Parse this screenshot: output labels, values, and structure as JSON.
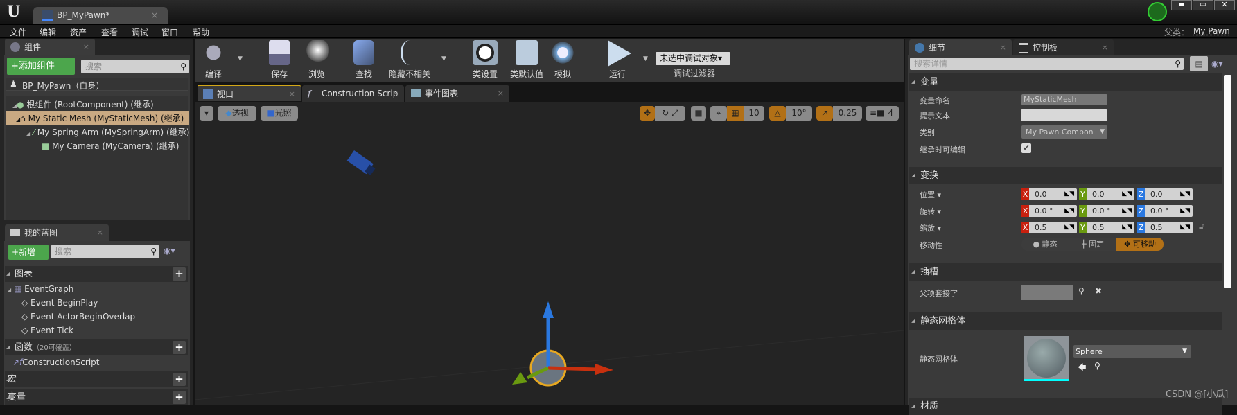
{
  "titlebar": {
    "tab_title": "BP_MyPawn*",
    "window_buttons": [
      "minimize",
      "maximize",
      "close"
    ]
  },
  "menu": [
    "文件",
    "编辑",
    "资产",
    "查看",
    "调试",
    "窗口",
    "帮助"
  ],
  "parent_class": {
    "label": "父类：",
    "value": "My Pawn"
  },
  "components": {
    "tab": "组件",
    "add_button": "+添加组件",
    "search_placeholder": "搜索",
    "self": "BP_MyPawn（自身）",
    "tree": [
      {
        "label": "根组件 (RootComponent) (继承)",
        "depth": 0,
        "selected": false
      },
      {
        "label": "My Static Mesh (MyStaticMesh) (继承)",
        "depth": 1,
        "selected": true
      },
      {
        "label": "My Spring Arm (MySpringArm) (继承)",
        "depth": 2,
        "selected": false
      },
      {
        "label": "My Camera (MyCamera) (继承)",
        "depth": 3,
        "selected": false
      }
    ]
  },
  "my_blueprint": {
    "tab": "我的蓝图",
    "new_button": "+新增",
    "search_placeholder": "搜索",
    "graphs": "图表",
    "event_graph": "EventGraph",
    "events": [
      "Event BeginPlay",
      "Event ActorBeginOverlap",
      "Event Tick"
    ],
    "functions": "函数",
    "functions_note": "（20可覆盖）",
    "construction_script": "ConstructionScript",
    "macros": "宏",
    "variables": "变量"
  },
  "toolbar": {
    "compile": "编译",
    "save": "保存",
    "browse": "浏览",
    "find": "查找",
    "hide_unrelated": "隐藏不相关",
    "class_settings": "类设置",
    "class_defaults": "类默认值",
    "simulate": "模拟",
    "play": "运行",
    "debug_object": "未选中调试对象▾",
    "debug_filter": "调试过滤器"
  },
  "editor_tabs": [
    "视口",
    "Construction Scrip",
    "事件图表"
  ],
  "viewport": {
    "perspective": "透视",
    "lit": "光照",
    "grid_snap": "10",
    "rotation_snap": "10°",
    "scale_snap": "0.25",
    "camera_speed": "4"
  },
  "details": {
    "tab": "细节",
    "tab2": "控制板",
    "search_placeholder": "搜索详情",
    "variable": {
      "header": "变量",
      "name_label": "变量命名",
      "name_value": "MyStaticMesh",
      "tooltip_label": "提示文本",
      "tooltip_value": "",
      "category_label": "类别",
      "category_value": "My Pawn Compon",
      "editable_label": "继承时可编辑",
      "editable": true
    },
    "transform": {
      "header": "变换",
      "location_label": "位置 ▾",
      "rotation_label": "旋转 ▾",
      "scale_label": "缩放 ▾",
      "location": [
        "0.0",
        "0.0",
        "0.0"
      ],
      "rotation": [
        "0.0 °",
        "0.0 °",
        "0.0 °"
      ],
      "scale": [
        "0.5",
        "0.5",
        "0.5"
      ],
      "mobility_label": "移动性",
      "mobility_options": [
        "静态",
        "固定",
        "可移动"
      ],
      "mobility_selected": "可移动"
    },
    "sockets": {
      "header": "插槽",
      "parent_socket_label": "父项套接字"
    },
    "static_mesh": {
      "header": "静态网格体",
      "label": "静态网格体",
      "value": "Sphere"
    },
    "material": {
      "header": "材质"
    }
  },
  "watermark": "CSDN @[小瓜]",
  "colors": {
    "accent_orange": "#b27016",
    "selected_row": "#c9a982",
    "add_green": "#4ca64c",
    "x_axis": "#c8200e",
    "y_axis": "#6a9a10",
    "z_axis": "#2a78e0"
  }
}
